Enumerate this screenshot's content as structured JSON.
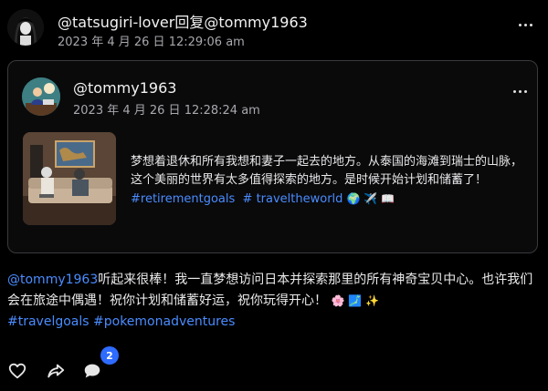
{
  "post": {
    "author": "@tatsugiri-lover",
    "reply_word": "回复",
    "reply_to": "@tommy1963",
    "timestamp": "2023 年 4 月 26 日 12:29:06 am",
    "avatar_icon": "avatar-figure-icon"
  },
  "quoted": {
    "author": "@tommy1963",
    "timestamp": "2023 年 4 月 26 日 12:28:24 am",
    "text": "梦想着退休和所有我想和妻子一起去的地方。从泰国的海滩到瑞士的山脉，这个美丽的世界有太多值得探索的地方。是时候开始计划和储蓄了！",
    "tag1": "#retirementgoals",
    "tag2": "# traveltheworld",
    "emojis": "🌍 ✈️ 📖"
  },
  "reply": {
    "mention": "@tommy1963",
    "text": "听起来很棒！我一直梦想访问日本并探索那里的所有神奇宝贝中心。也许我们会在旅途中偶遇！祝你计划和储蓄好运，祝你玩得开心！",
    "emojis": "🌸 🗾 ✨",
    "tags": "#travelgoals #pokemonadventures"
  },
  "actions": {
    "comment_count": "2"
  },
  "colors": {
    "link": "#4a8cff",
    "badge": "#2e6bff"
  }
}
